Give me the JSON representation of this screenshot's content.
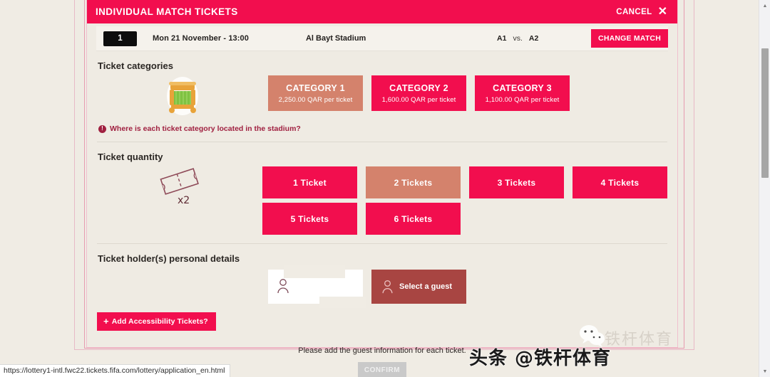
{
  "window": {
    "status_url": "https://lottery1-intl.fwc22.tickets.fifa.com/lottery/application_en.html"
  },
  "panel": {
    "title": "INDIVIDUAL MATCH TICKETS",
    "cancel_label": "CANCEL",
    "close_icon": "✕"
  },
  "match": {
    "number": "1",
    "datetime": "Mon 21 November - 13:00",
    "venue": "Al Bayt Stadium",
    "home_team": "A1",
    "vs_label": "vs.",
    "away_team": "A2",
    "change_button": "CHANGE MATCH"
  },
  "categories_section": {
    "title": "Ticket categories",
    "icon": "stadium-icon",
    "info_link": "Where is each ticket category located in the stadium?",
    "info_icon": "!",
    "options": [
      {
        "label": "CATEGORY 1",
        "price": "2,250.00 QAR per ticket",
        "selected": true
      },
      {
        "label": "CATEGORY 2",
        "price": "1,600.00 QAR per ticket",
        "selected": false
      },
      {
        "label": "CATEGORY 3",
        "price": "1,100.00 QAR per ticket",
        "selected": false
      }
    ]
  },
  "quantity_section": {
    "title": "Ticket quantity",
    "icon": "ticket-icon",
    "icon_caption": "x2",
    "options": [
      {
        "label": "1 Ticket",
        "selected": false
      },
      {
        "label": "2 Tickets",
        "selected": true
      },
      {
        "label": "3 Tickets",
        "selected": false
      },
      {
        "label": "4 Tickets",
        "selected": false
      },
      {
        "label": "5 Tickets",
        "selected": false
      },
      {
        "label": "6 Tickets",
        "selected": false
      }
    ]
  },
  "holders_section": {
    "title": "Ticket holder(s) personal details",
    "holder_field_value": "",
    "select_guest_label": "Select a guest",
    "accessibility_button": "Add Accessibility Tickets?",
    "accessibility_plus": "+"
  },
  "footer": {
    "note": "Please add the guest information for each ticket.",
    "confirm_label": "CONFIRM"
  },
  "watermark": {
    "faint": "铁杆体育",
    "main": "头条 @铁杆体育"
  },
  "colors": {
    "brand_pink": "#f20e4e",
    "selected_muted": "#d4826c",
    "guest_red": "#a84542",
    "page_bg": "#efebe3"
  }
}
